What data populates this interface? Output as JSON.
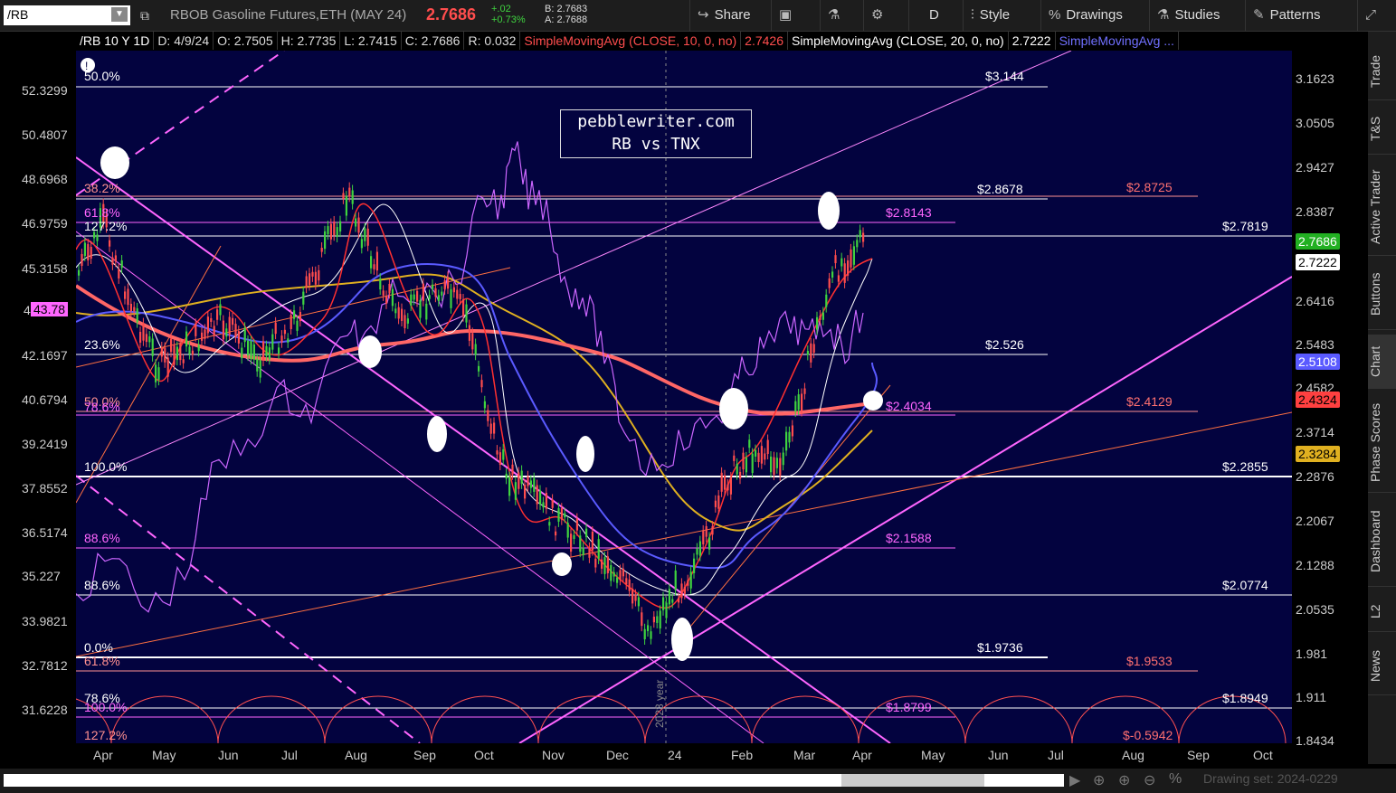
{
  "toolbar": {
    "symbol": "/RB",
    "instrument": "RBOB Gasoline Futures,ETH (MAY 24)",
    "last": "2.7686",
    "change": "+.02",
    "change_pct": "+0.73%",
    "bid": "B: 2.7683",
    "ask": "A: 2.7688",
    "share": "Share",
    "timeframe": "D",
    "style": "Style",
    "drawings": "Drawings",
    "studies": "Studies",
    "patterns": "Patterns"
  },
  "info": {
    "symbol": "/RB 10 Y 1D",
    "date": "D: 4/9/24",
    "open": "O: 2.7505",
    "high": "H: 2.7735",
    "low": "L: 2.7415",
    "close": "C: 2.7686",
    "range": "R: 0.032",
    "sma10": "SimpleMovingAvg (CLOSE, 10, 0, no)",
    "sma10_val": "2.7426",
    "sma20": "SimpleMovingAvg (CLOSE, 20, 0, no)",
    "sma20_val": "2.7222",
    "sma_more": "SimpleMovingAvg ..."
  },
  "watermark": {
    "line1": "pebblewriter.com",
    "line2": "RB vs TNX"
  },
  "left_axis": [
    "52.3299",
    "50.4807",
    "48.6968",
    "46.9759",
    "45.3158",
    "4",
    "42.1697",
    "40.6794",
    "39.2419",
    "37.8552",
    "36.5174",
    "35.227",
    "33.9821",
    "32.7812",
    "31.6228"
  ],
  "left_tag": "43.78",
  "right_axis": [
    "3.1623",
    "3.0505",
    "2.9427",
    "2.8387",
    "2.6416",
    "2.5483",
    "2.4582",
    "2.3714",
    "2.2876",
    "2.2067",
    "2.1288",
    "2.0535",
    "1.981",
    "1.911",
    "1.8434"
  ],
  "right_tags": [
    "2.7686",
    "2.7222",
    "2.5108",
    "2.4324",
    "2.3284"
  ],
  "x_axis": [
    "Apr",
    "May",
    "Jun",
    "Jul",
    "Aug",
    "Sep",
    "Oct",
    "Nov",
    "Dec",
    "24",
    "Feb",
    "Mar",
    "Apr",
    "May",
    "Jun",
    "Jul",
    "Aug",
    "Sep",
    "Oct"
  ],
  "year_marker": "2023 year",
  "levels": {
    "l50": "50.0%",
    "l3144": "$3.144",
    "l382": "38.2%",
    "l28678": "$2.8678",
    "l28725": "$2.8725",
    "l618": "61.8%",
    "l28143": "$2.8143",
    "l1272": "127.2%",
    "l27819": "$2.7819",
    "l236": "23.6%",
    "l2526": "$2.526",
    "l50b": "50.0%",
    "l786": "78.6%",
    "l24034": "$2.4034",
    "l24129": "$2.4129",
    "l100": "100.0%",
    "l22855": "$2.2855",
    "l886a": "88.6%",
    "l21588": "$2.1588",
    "l886b": "88.6%",
    "l20774": "$2.0774",
    "l00": "0.0%",
    "l19736": "$1.9736",
    "l618b": "61.8%",
    "l19533": "$1.9533",
    "l786b": "78.6%",
    "l18949": "$1.8949",
    "l100b": "100.0%",
    "l18799": "$1.8799",
    "l1272b": "127.2%",
    "l05942": "$-0.5942"
  },
  "sidebar": [
    "Trade",
    "T&S",
    "Active Trader",
    "Buttons",
    "Chart",
    "Phase Scores",
    "Dashboard",
    "L2",
    "News"
  ],
  "drawing_set": "Drawing set: 2024-0229",
  "colors": {
    "plot_bg": "#03033f",
    "up": "#3fd33f",
    "down": "#ff4d4d",
    "magenta": "#ff66ff",
    "orange": "#ff8844",
    "yellow": "#e0b020",
    "blue": "#5a5aff",
    "red_ma": "#ff6666"
  }
}
